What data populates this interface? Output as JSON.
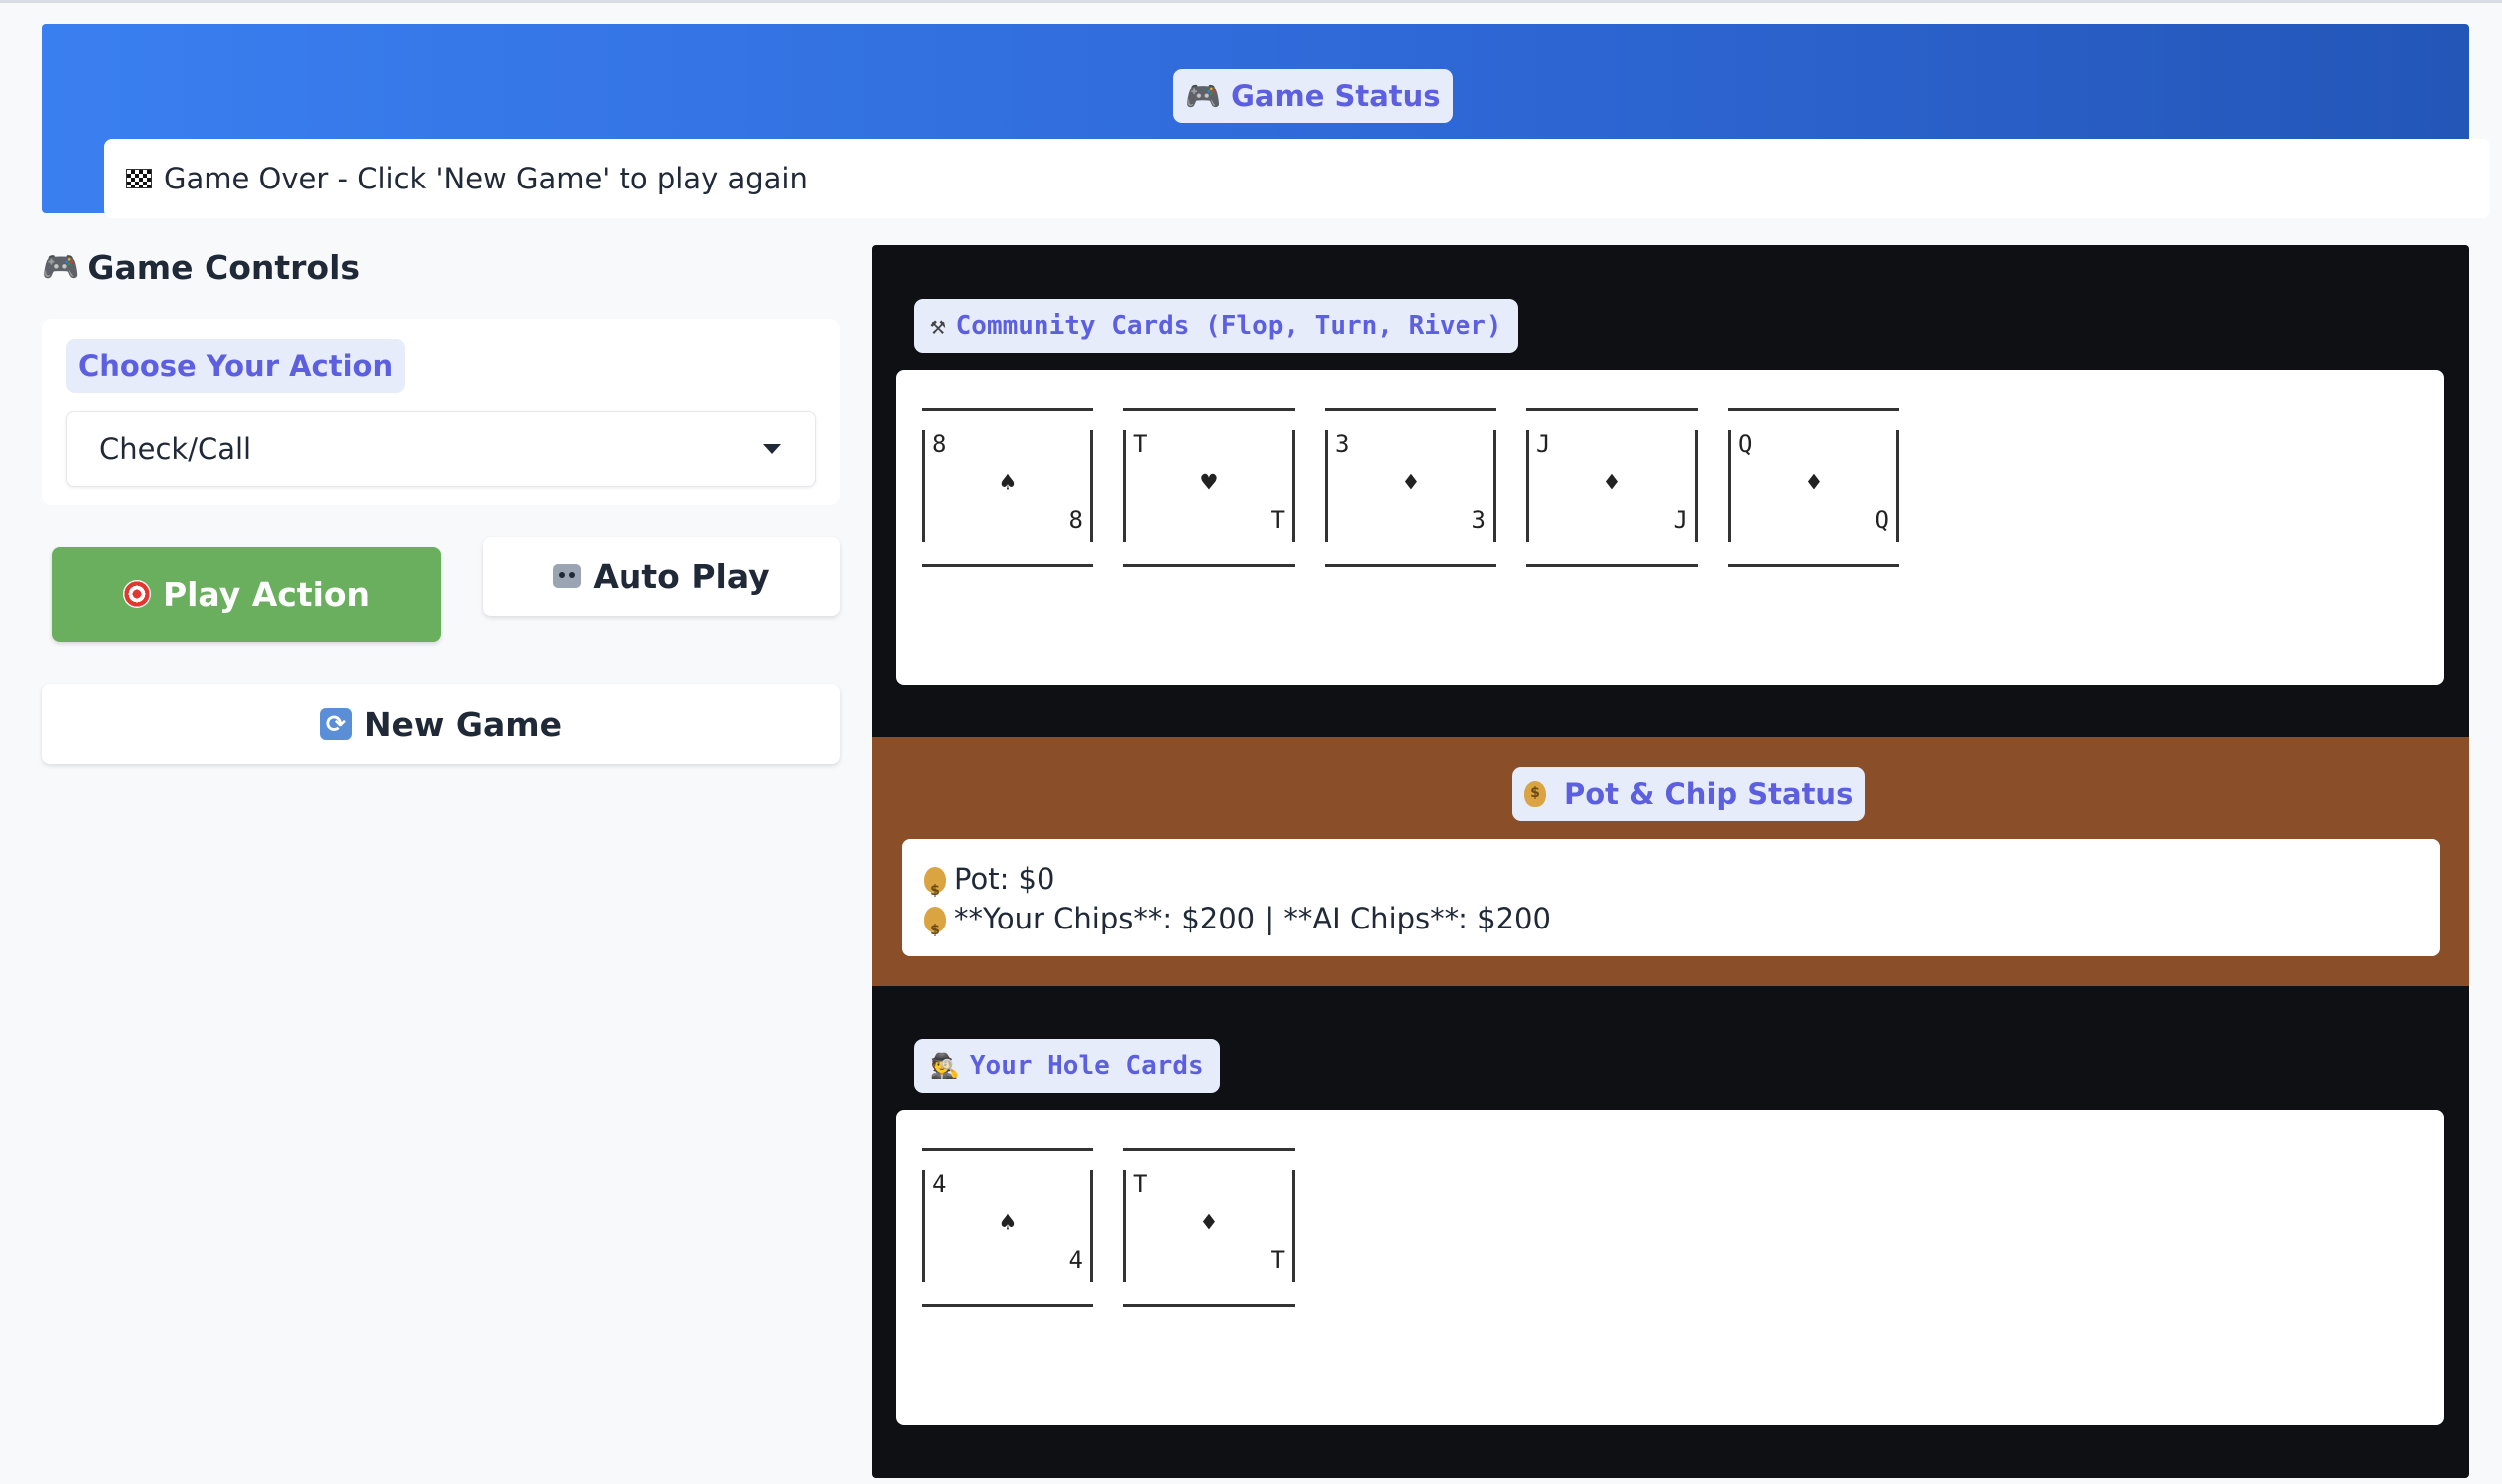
{
  "status": {
    "title": "Game Status",
    "title_icon": "gamepad-icon",
    "message": "Game Over - Click 'New Game' to play again",
    "message_icon": "checkered-flag-icon"
  },
  "controls": {
    "title": "Game Controls",
    "action_label": "Choose Your Action",
    "selected_action": "Check/Call",
    "play_button": "Play Action",
    "auto_button": "Auto Play",
    "new_game_button": "New Game"
  },
  "community": {
    "title": "Community Cards (Flop, Turn, River)",
    "cards": [
      {
        "rank": "8",
        "suit": "♠"
      },
      {
        "rank": "T",
        "suit": "♥"
      },
      {
        "rank": "3",
        "suit": "♦"
      },
      {
        "rank": "J",
        "suit": "♦"
      },
      {
        "rank": "Q",
        "suit": "♦"
      }
    ]
  },
  "chips": {
    "title": "Pot & Chip Status",
    "pot_line": "Pot: $0",
    "stacks_line": "**Your Chips**: $200 | **AI Chips**: $200"
  },
  "hole": {
    "title": "Your Hole Cards",
    "cards": [
      {
        "rank": "4",
        "suit": "♠"
      },
      {
        "rank": "T",
        "suit": "♦"
      }
    ]
  },
  "colors": {
    "banner_blue": "#3a7ff0",
    "play_green": "#6aaf5e",
    "chip_band_brown": "#8a4f28",
    "pill_text": "#5b5fe0",
    "table_dark": "#0e1014"
  }
}
